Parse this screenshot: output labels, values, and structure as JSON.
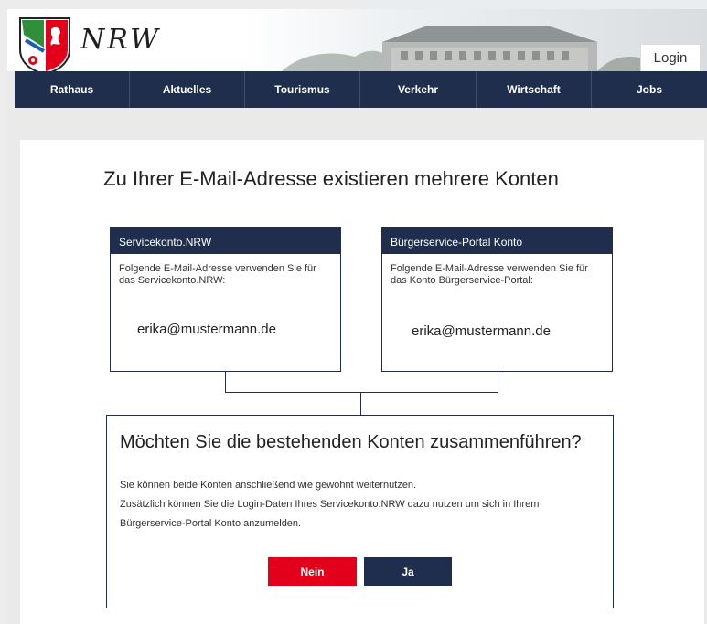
{
  "header": {
    "brand": "NRW",
    "login_label": "Login"
  },
  "nav": {
    "items": [
      {
        "label": "Rathaus"
      },
      {
        "label": "Aktuelles"
      },
      {
        "label": "Tourismus"
      },
      {
        "label": "Verkehr"
      },
      {
        "label": "Wirtschaft"
      },
      {
        "label": "Jobs"
      }
    ]
  },
  "main": {
    "title": "Zu Ihrer E-Mail-Adresse existieren mehrere Konten",
    "accounts": [
      {
        "header": "Servicekonto.NRW",
        "description": "Folgende E-Mail-Adresse verwenden Sie für das Servicekonto.NRW:",
        "email": "erika@mustermann.de"
      },
      {
        "header": "Bürgerservice-Portal Konto",
        "description": "Folgende E-Mail-Adresse verwenden Sie für das Konto Bürgerservice-Portal:",
        "email": "erika@mustermann.de"
      }
    ],
    "merge": {
      "question": "Möchten Sie die bestehenden Konten zusammenführen?",
      "text_lines": [
        "Sie können beide Konten anschließend wie gewohnt weiternutzen.",
        "Zusätzlich können Sie die Login-Daten Ihres Servicekonto.NRW dazu nutzen um sich in Ihrem",
        "Bürgerservice-Portal Konto anzumelden."
      ],
      "no_label": "Nein",
      "yes_label": "Ja"
    }
  },
  "colors": {
    "navy": "#1f2e4c",
    "red": "#e2001a",
    "green": "#2f8f3a"
  }
}
